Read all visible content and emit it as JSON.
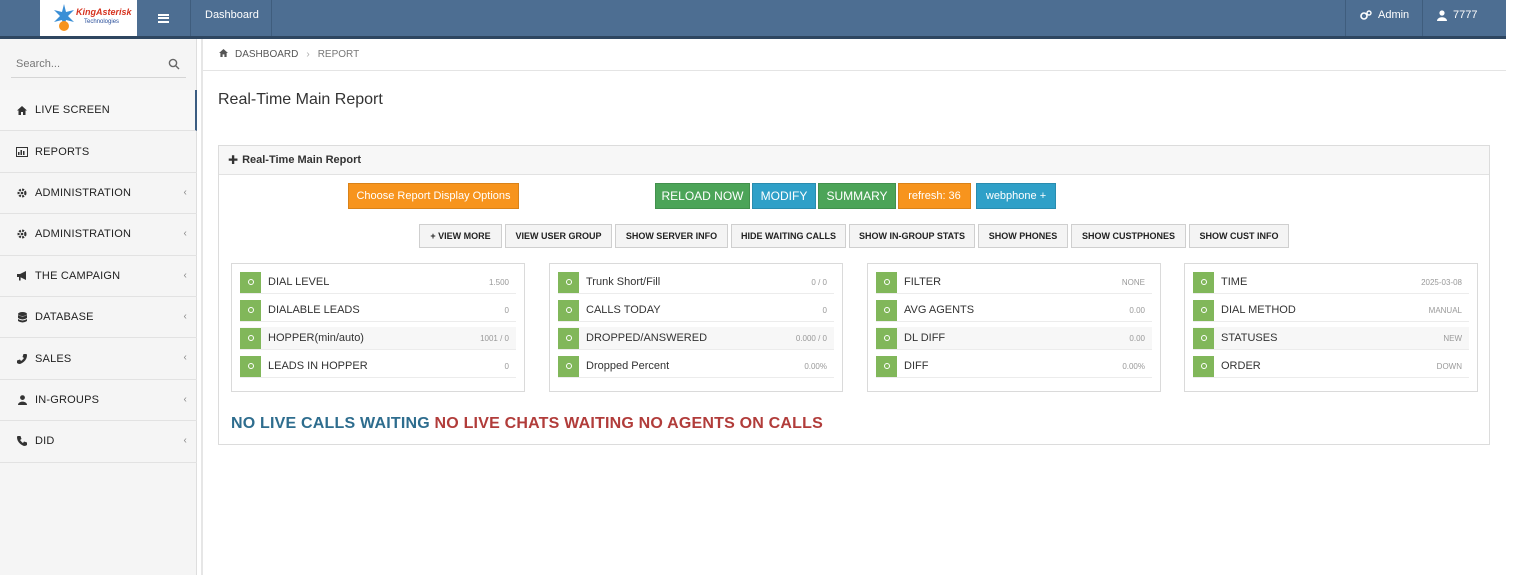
{
  "topbar": {
    "logo_text": "KingAsterisk",
    "logo_sub": "Technologies",
    "title": "Dashboard",
    "admin_label": "Admin",
    "user_label": "7777",
    "bg_color": "#4d6e92"
  },
  "sidebar": {
    "search_placeholder": "Search...",
    "items": [
      {
        "label": "LIVE SCREEN",
        "icon": "home-icon",
        "active": true
      },
      {
        "label": "REPORTS",
        "icon": "bar-chart-icon"
      },
      {
        "label": "ADMINISTRATION",
        "icon": "gear-icon"
      },
      {
        "label": "ADMINISTRATION",
        "icon": "gear-icon"
      },
      {
        "label": "THE CAMPAIGN",
        "icon": "bullhorn-icon"
      },
      {
        "label": "DATABASE",
        "icon": "database-icon"
      },
      {
        "label": "SALES",
        "icon": "phone-icon"
      },
      {
        "label": "IN-GROUPS",
        "icon": "user-icon"
      },
      {
        "label": "DID",
        "icon": "phone-icon"
      }
    ]
  },
  "breadcrumb": {
    "home": "DASHBOARD",
    "current": "REPORT"
  },
  "page_title": "Real-Time Main Report",
  "panel": {
    "title": "Real-Time Main Report",
    "buttons": {
      "choose": "Choose Report Display Options",
      "reload": "RELOAD NOW",
      "modify": "MODIFY",
      "summary": "SUMMARY",
      "refresh": "refresh: 36",
      "webphone": "webphone +"
    },
    "small_buttons": [
      "+ VIEW MORE",
      "VIEW USER GROUP",
      "SHOW SERVER INFO",
      "HIDE WAITING CALLS",
      "SHOW IN-GROUP STATS",
      "SHOW PHONES",
      "SHOW CUSTPHONES",
      "SHOW CUST INFO"
    ],
    "stats": [
      [
        {
          "label": "DIAL LEVEL",
          "value": "1.500"
        },
        {
          "label": "DIALABLE LEADS",
          "value": "0"
        },
        {
          "label": "HOPPER(min/auto)",
          "value": "1001 / 0"
        },
        {
          "label": "LEADS IN HOPPER",
          "value": "0"
        }
      ],
      [
        {
          "label": "Trunk Short/Fill",
          "value": "0 / 0"
        },
        {
          "label": "CALLS TODAY",
          "value": "0"
        },
        {
          "label": "DROPPED/ANSWERED",
          "value": "0.000 / 0"
        },
        {
          "label": "Dropped Percent",
          "value": "0.00%"
        }
      ],
      [
        {
          "label": "FILTER",
          "value": "NONE"
        },
        {
          "label": "AVG AGENTS",
          "value": "0.00"
        },
        {
          "label": "DL DIFF",
          "value": "0.00"
        },
        {
          "label": "DIFF",
          "value": "0.00%"
        }
      ],
      [
        {
          "label": "TIME",
          "value": "2025-03-08"
        },
        {
          "label": "DIAL METHOD",
          "value": "MANUAL"
        },
        {
          "label": "STATUSES",
          "value": "NEW"
        },
        {
          "label": "ORDER",
          "value": "DOWN"
        }
      ]
    ],
    "status": {
      "calls": "NO LIVE CALLS WAITING",
      "chats": "NO LIVE CHATS WAITING",
      "agents": "NO AGENTS ON CALLS"
    }
  }
}
